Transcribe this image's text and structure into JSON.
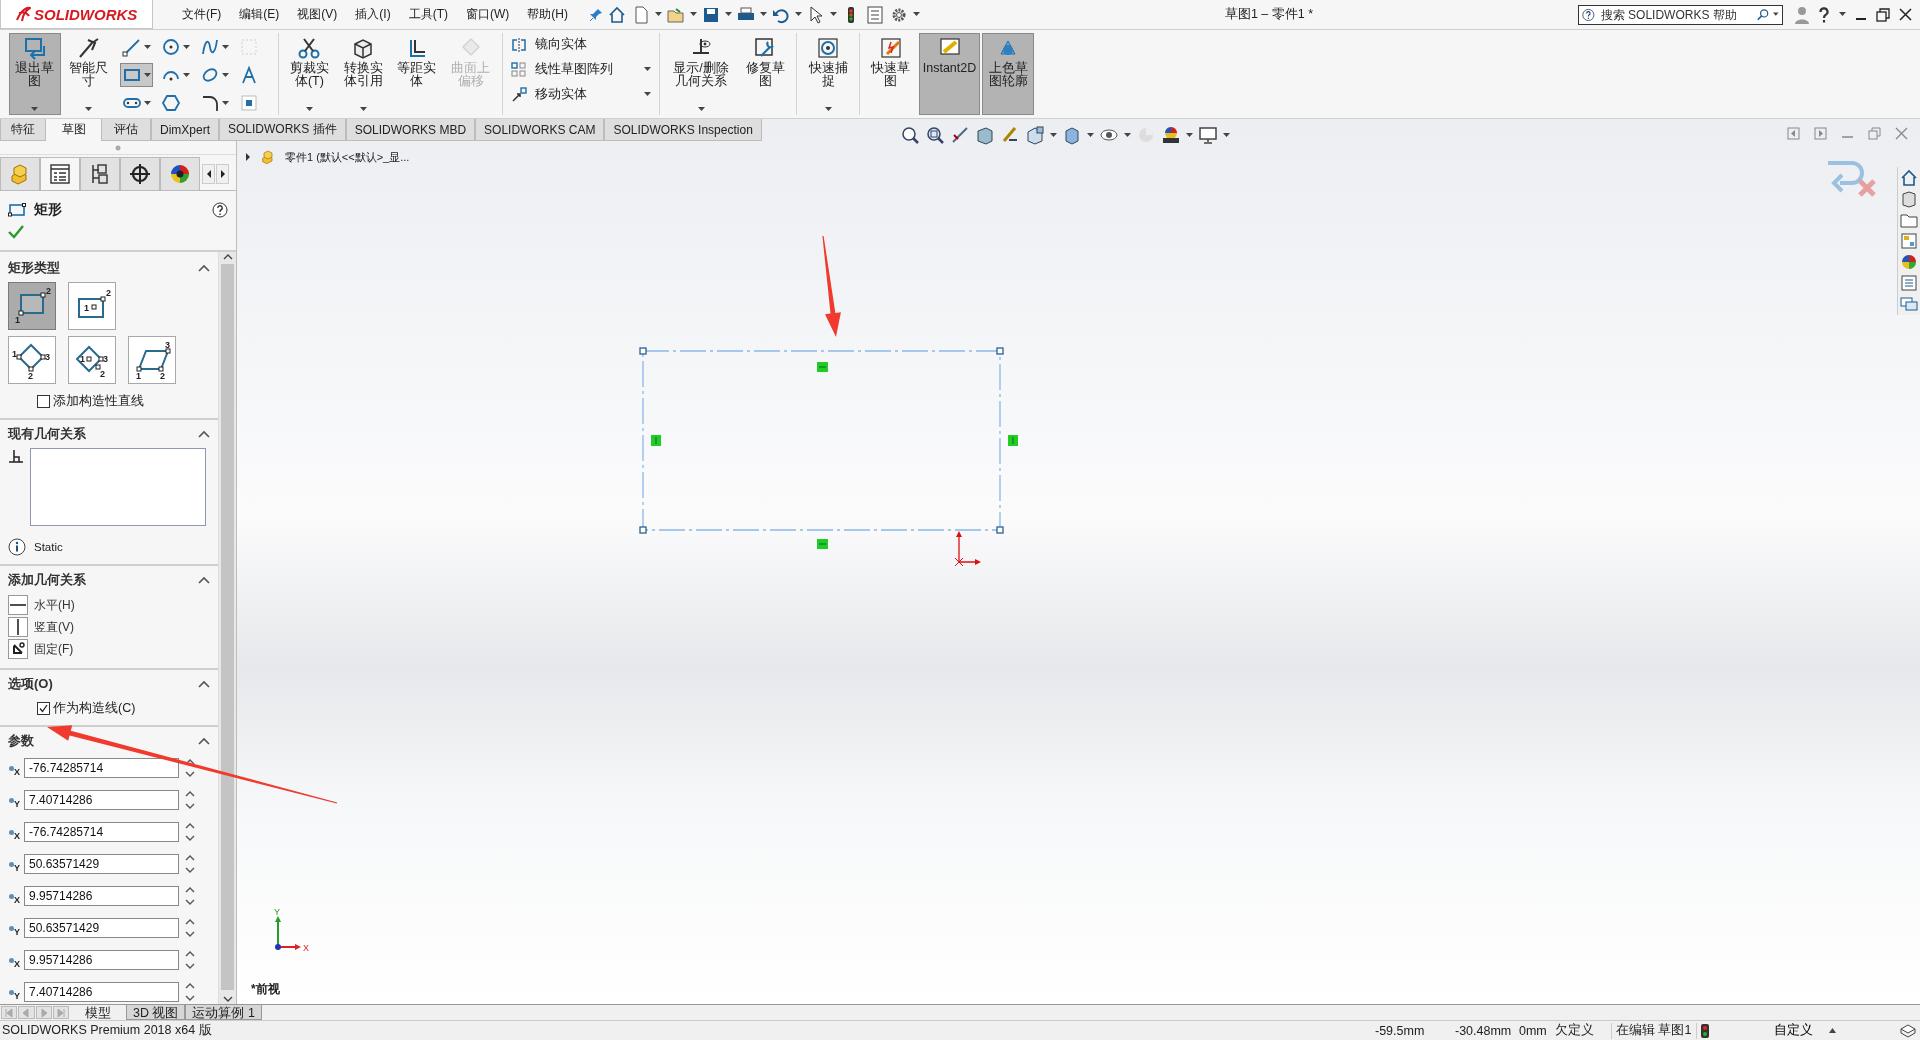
{
  "logo": {
    "text": "SOLIDWORKS"
  },
  "menu": [
    {
      "label": "文件(F)"
    },
    {
      "label": "编辑(E)"
    },
    {
      "label": "视图(V)"
    },
    {
      "label": "插入(I)"
    },
    {
      "label": "工具(T)"
    },
    {
      "label": "窗口(W)"
    },
    {
      "label": "帮助(H)"
    }
  ],
  "window_title": "草图1 – 零件1 *",
  "help_search": {
    "placeholder": "搜索 SOLIDWORKS 帮助"
  },
  "ribbon": [
    {
      "kind": "large",
      "buttons": [
        {
          "label": "退出草图",
          "selected": true,
          "disabled": false,
          "dropdown": true
        },
        {
          "label": "智能尺寸",
          "selected": false,
          "disabled": false,
          "dropdown": true
        }
      ]
    },
    {
      "kind": "tools",
      "tools": [
        {
          "selected": false,
          "disabled": false,
          "dropdown": true
        },
        {
          "selected": false,
          "disabled": false,
          "dropdown": true
        },
        {
          "selected": false,
          "disabled": false,
          "dropdown": true
        },
        {
          "selected": false,
          "disabled": true,
          "dropdown": false
        },
        {
          "selected": true,
          "disabled": false,
          "dropdown": true
        },
        {
          "selected": false,
          "disabled": false,
          "dropdown": true
        },
        {
          "selected": false,
          "disabled": false,
          "dropdown": true
        },
        {
          "selected": false,
          "disabled": false,
          "dropdown": false
        },
        {
          "selected": false,
          "disabled": false,
          "dropdown": true
        },
        {
          "selected": false,
          "disabled": false,
          "dropdown": false
        },
        {
          "selected": false,
          "disabled": false,
          "dropdown": true
        },
        {
          "selected": false,
          "disabled": false,
          "dropdown": false
        }
      ]
    },
    {
      "kind": "large",
      "buttons": [
        {
          "label": "剪裁实体(T)",
          "selected": false,
          "disabled": false,
          "dropdown": true
        },
        {
          "label": "转换实体引用",
          "selected": false,
          "disabled": false,
          "dropdown": true
        },
        {
          "label": "等距实体",
          "selected": false,
          "disabled": false,
          "dropdown": false
        },
        {
          "label": "曲面上偏移",
          "selected": false,
          "disabled": true,
          "dropdown": false
        }
      ]
    },
    {
      "kind": "commands",
      "commands": [
        {
          "label": "镜向实体",
          "dropdown": false
        },
        {
          "label": "线性草图阵列",
          "dropdown": true
        },
        {
          "label": "移动实体",
          "dropdown": true
        }
      ]
    },
    {
      "kind": "large",
      "buttons": [
        {
          "label": "显示/删除几何关系",
          "selected": false,
          "disabled": false,
          "dropdown": true
        },
        {
          "label": "修复草图",
          "selected": false,
          "disabled": false,
          "dropdown": false
        }
      ]
    },
    {
      "kind": "large",
      "buttons": [
        {
          "label": "快速捕捉",
          "selected": false,
          "disabled": false,
          "dropdown": true
        }
      ]
    },
    {
      "kind": "large",
      "buttons": [
        {
          "label": "快速草图",
          "selected": false,
          "disabled": false,
          "dropdown": false
        },
        {
          "label": "Instant2D",
          "selected": true,
          "disabled": false,
          "dropdown": false
        },
        {
          "label": "上色草图轮廓",
          "selected": true,
          "disabled": false,
          "dropdown": false
        }
      ]
    }
  ],
  "command_tabs": [
    {
      "label": "特征",
      "selected": false
    },
    {
      "label": "草图",
      "selected": true
    },
    {
      "label": "评估",
      "selected": false
    },
    {
      "label": "DimXpert",
      "selected": false
    },
    {
      "label": "SOLIDWORKS 插件",
      "selected": false
    },
    {
      "label": "SOLIDWORKS MBD",
      "selected": false
    },
    {
      "label": "SOLIDWORKS CAM",
      "selected": false
    },
    {
      "label": "SOLIDWORKS Inspection",
      "selected": false
    }
  ],
  "panel": {
    "tabs": [
      {
        "kind": "feature-tree",
        "selected": false
      },
      {
        "kind": "property-manager",
        "selected": true
      },
      {
        "kind": "configuration",
        "selected": false
      },
      {
        "kind": "dimxpert",
        "selected": false
      },
      {
        "kind": "display",
        "selected": false
      }
    ],
    "title": "矩形",
    "sections": [
      {
        "kind": "types",
        "title": "矩形类型",
        "expanded": true,
        "types": [
          {
            "kind": "corner",
            "selected": true,
            "points": [
              "1",
              "2"
            ]
          },
          {
            "kind": "center",
            "selected": false,
            "points": [
              "1",
              "2"
            ]
          },
          {
            "kind": "three-point-corner",
            "selected": false,
            "points": [
              "1",
              "2",
              "3"
            ]
          },
          {
            "kind": "three-point-center",
            "selected": false,
            "points": [
              "1",
              "2",
              "3"
            ]
          },
          {
            "kind": "parallelogram",
            "selected": false,
            "points": [
              "1",
              "2",
              "3"
            ]
          }
        ],
        "checkbox": {
          "label": "添加构造性直线",
          "checked": false
        }
      },
      {
        "kind": "existing",
        "title": "现有几何关系",
        "expanded": true,
        "status": "Static"
      },
      {
        "kind": "add",
        "title": "添加几何关系",
        "expanded": true,
        "relations": [
          {
            "kind": "horizontal",
            "label": "水平(H)"
          },
          {
            "kind": "vertical",
            "label": "竖直(V)"
          },
          {
            "kind": "fixed",
            "label": "固定(F)"
          }
        ]
      },
      {
        "kind": "options",
        "title": "选项(O)",
        "expanded": true,
        "checkbox": {
          "label": "作为构造线(C)",
          "checked": true
        }
      },
      {
        "kind": "params",
        "title": "参数",
        "expanded": true,
        "fields": [
          {
            "axis": "X",
            "value": "-76.74285714"
          },
          {
            "axis": "Y",
            "value": "7.40714286"
          },
          {
            "axis": "X",
            "value": "-76.74285714"
          },
          {
            "axis": "Y",
            "value": "50.63571429"
          },
          {
            "axis": "X",
            "value": "9.95714286"
          },
          {
            "axis": "Y",
            "value": "50.63571429"
          },
          {
            "axis": "X",
            "value": "9.95714286"
          },
          {
            "axis": "Y",
            "value": "7.40714286"
          }
        ]
      }
    ]
  },
  "viewport": {
    "breadcrumb": "零件1 (默认<<默认>_显...",
    "view_name": "*前视",
    "axes": {
      "x": "X",
      "y": "Y"
    }
  },
  "bottom_tabs": [
    {
      "label": "模型",
      "selected": true
    },
    {
      "label": "3D 视图",
      "selected": false
    },
    {
      "label": "运动算例 1",
      "selected": false
    }
  ],
  "status_bar": {
    "product": "SOLIDWORKS Premium 2018 x64 版",
    "x": "-59.5mm",
    "y": "-30.48mm",
    "z": "0mm",
    "definition": "欠定义",
    "editing": "在编辑 草图1",
    "units": "自定义"
  }
}
